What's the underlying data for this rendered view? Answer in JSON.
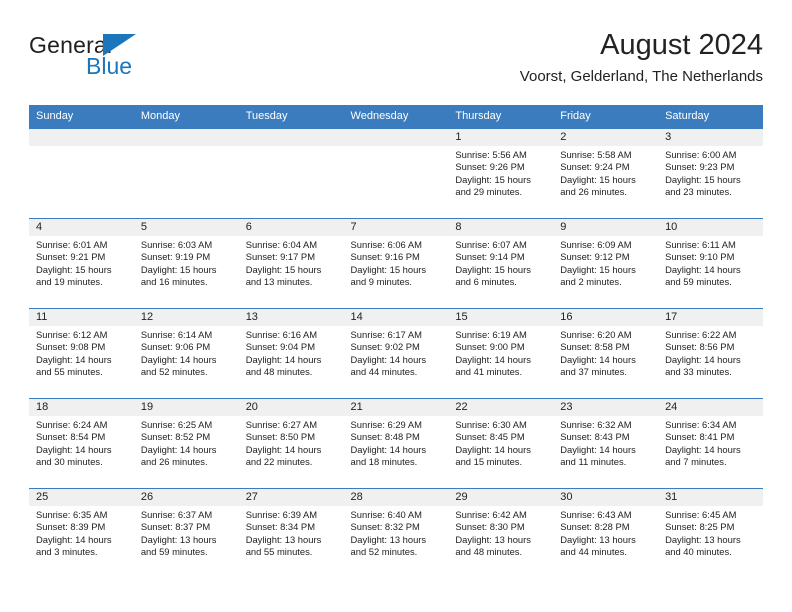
{
  "brand": {
    "name_top": "General",
    "name_bottom": "Blue",
    "accent_color": "#1b76bc",
    "flag_icon": "triangle-flag-icon"
  },
  "header": {
    "title": "August 2024",
    "subtitle": "Voorst, Gelderland, The Netherlands"
  },
  "calendar": {
    "header_bg": "#3a7cbe",
    "daynum_bg": "#f0f0f0",
    "weekdays": [
      "Sunday",
      "Monday",
      "Tuesday",
      "Wednesday",
      "Thursday",
      "Friday",
      "Saturday"
    ],
    "labels": {
      "sunrise": "Sunrise:",
      "sunset": "Sunset:",
      "daylight": "Daylight:"
    },
    "weeks": [
      [
        {
          "day": "",
          "sunrise": "",
          "sunset": "",
          "daylight1": "",
          "daylight2": ""
        },
        {
          "day": "",
          "sunrise": "",
          "sunset": "",
          "daylight1": "",
          "daylight2": ""
        },
        {
          "day": "",
          "sunrise": "",
          "sunset": "",
          "daylight1": "",
          "daylight2": ""
        },
        {
          "day": "",
          "sunrise": "",
          "sunset": "",
          "daylight1": "",
          "daylight2": ""
        },
        {
          "day": "1",
          "sunrise": "Sunrise: 5:56 AM",
          "sunset": "Sunset: 9:26 PM",
          "daylight1": "Daylight: 15 hours",
          "daylight2": "and 29 minutes."
        },
        {
          "day": "2",
          "sunrise": "Sunrise: 5:58 AM",
          "sunset": "Sunset: 9:24 PM",
          "daylight1": "Daylight: 15 hours",
          "daylight2": "and 26 minutes."
        },
        {
          "day": "3",
          "sunrise": "Sunrise: 6:00 AM",
          "sunset": "Sunset: 9:23 PM",
          "daylight1": "Daylight: 15 hours",
          "daylight2": "and 23 minutes."
        }
      ],
      [
        {
          "day": "4",
          "sunrise": "Sunrise: 6:01 AM",
          "sunset": "Sunset: 9:21 PM",
          "daylight1": "Daylight: 15 hours",
          "daylight2": "and 19 minutes."
        },
        {
          "day": "5",
          "sunrise": "Sunrise: 6:03 AM",
          "sunset": "Sunset: 9:19 PM",
          "daylight1": "Daylight: 15 hours",
          "daylight2": "and 16 minutes."
        },
        {
          "day": "6",
          "sunrise": "Sunrise: 6:04 AM",
          "sunset": "Sunset: 9:17 PM",
          "daylight1": "Daylight: 15 hours",
          "daylight2": "and 13 minutes."
        },
        {
          "day": "7",
          "sunrise": "Sunrise: 6:06 AM",
          "sunset": "Sunset: 9:16 PM",
          "daylight1": "Daylight: 15 hours",
          "daylight2": "and 9 minutes."
        },
        {
          "day": "8",
          "sunrise": "Sunrise: 6:07 AM",
          "sunset": "Sunset: 9:14 PM",
          "daylight1": "Daylight: 15 hours",
          "daylight2": "and 6 minutes."
        },
        {
          "day": "9",
          "sunrise": "Sunrise: 6:09 AM",
          "sunset": "Sunset: 9:12 PM",
          "daylight1": "Daylight: 15 hours",
          "daylight2": "and 2 minutes."
        },
        {
          "day": "10",
          "sunrise": "Sunrise: 6:11 AM",
          "sunset": "Sunset: 9:10 PM",
          "daylight1": "Daylight: 14 hours",
          "daylight2": "and 59 minutes."
        }
      ],
      [
        {
          "day": "11",
          "sunrise": "Sunrise: 6:12 AM",
          "sunset": "Sunset: 9:08 PM",
          "daylight1": "Daylight: 14 hours",
          "daylight2": "and 55 minutes."
        },
        {
          "day": "12",
          "sunrise": "Sunrise: 6:14 AM",
          "sunset": "Sunset: 9:06 PM",
          "daylight1": "Daylight: 14 hours",
          "daylight2": "and 52 minutes."
        },
        {
          "day": "13",
          "sunrise": "Sunrise: 6:16 AM",
          "sunset": "Sunset: 9:04 PM",
          "daylight1": "Daylight: 14 hours",
          "daylight2": "and 48 minutes."
        },
        {
          "day": "14",
          "sunrise": "Sunrise: 6:17 AM",
          "sunset": "Sunset: 9:02 PM",
          "daylight1": "Daylight: 14 hours",
          "daylight2": "and 44 minutes."
        },
        {
          "day": "15",
          "sunrise": "Sunrise: 6:19 AM",
          "sunset": "Sunset: 9:00 PM",
          "daylight1": "Daylight: 14 hours",
          "daylight2": "and 41 minutes."
        },
        {
          "day": "16",
          "sunrise": "Sunrise: 6:20 AM",
          "sunset": "Sunset: 8:58 PM",
          "daylight1": "Daylight: 14 hours",
          "daylight2": "and 37 minutes."
        },
        {
          "day": "17",
          "sunrise": "Sunrise: 6:22 AM",
          "sunset": "Sunset: 8:56 PM",
          "daylight1": "Daylight: 14 hours",
          "daylight2": "and 33 minutes."
        }
      ],
      [
        {
          "day": "18",
          "sunrise": "Sunrise: 6:24 AM",
          "sunset": "Sunset: 8:54 PM",
          "daylight1": "Daylight: 14 hours",
          "daylight2": "and 30 minutes."
        },
        {
          "day": "19",
          "sunrise": "Sunrise: 6:25 AM",
          "sunset": "Sunset: 8:52 PM",
          "daylight1": "Daylight: 14 hours",
          "daylight2": "and 26 minutes."
        },
        {
          "day": "20",
          "sunrise": "Sunrise: 6:27 AM",
          "sunset": "Sunset: 8:50 PM",
          "daylight1": "Daylight: 14 hours",
          "daylight2": "and 22 minutes."
        },
        {
          "day": "21",
          "sunrise": "Sunrise: 6:29 AM",
          "sunset": "Sunset: 8:48 PM",
          "daylight1": "Daylight: 14 hours",
          "daylight2": "and 18 minutes."
        },
        {
          "day": "22",
          "sunrise": "Sunrise: 6:30 AM",
          "sunset": "Sunset: 8:45 PM",
          "daylight1": "Daylight: 14 hours",
          "daylight2": "and 15 minutes."
        },
        {
          "day": "23",
          "sunrise": "Sunrise: 6:32 AM",
          "sunset": "Sunset: 8:43 PM",
          "daylight1": "Daylight: 14 hours",
          "daylight2": "and 11 minutes."
        },
        {
          "day": "24",
          "sunrise": "Sunrise: 6:34 AM",
          "sunset": "Sunset: 8:41 PM",
          "daylight1": "Daylight: 14 hours",
          "daylight2": "and 7 minutes."
        }
      ],
      [
        {
          "day": "25",
          "sunrise": "Sunrise: 6:35 AM",
          "sunset": "Sunset: 8:39 PM",
          "daylight1": "Daylight: 14 hours",
          "daylight2": "and 3 minutes."
        },
        {
          "day": "26",
          "sunrise": "Sunrise: 6:37 AM",
          "sunset": "Sunset: 8:37 PM",
          "daylight1": "Daylight: 13 hours",
          "daylight2": "and 59 minutes."
        },
        {
          "day": "27",
          "sunrise": "Sunrise: 6:39 AM",
          "sunset": "Sunset: 8:34 PM",
          "daylight1": "Daylight: 13 hours",
          "daylight2": "and 55 minutes."
        },
        {
          "day": "28",
          "sunrise": "Sunrise: 6:40 AM",
          "sunset": "Sunset: 8:32 PM",
          "daylight1": "Daylight: 13 hours",
          "daylight2": "and 52 minutes."
        },
        {
          "day": "29",
          "sunrise": "Sunrise: 6:42 AM",
          "sunset": "Sunset: 8:30 PM",
          "daylight1": "Daylight: 13 hours",
          "daylight2": "and 48 minutes."
        },
        {
          "day": "30",
          "sunrise": "Sunrise: 6:43 AM",
          "sunset": "Sunset: 8:28 PM",
          "daylight1": "Daylight: 13 hours",
          "daylight2": "and 44 minutes."
        },
        {
          "day": "31",
          "sunrise": "Sunrise: 6:45 AM",
          "sunset": "Sunset: 8:25 PM",
          "daylight1": "Daylight: 13 hours",
          "daylight2": "and 40 minutes."
        }
      ]
    ]
  }
}
